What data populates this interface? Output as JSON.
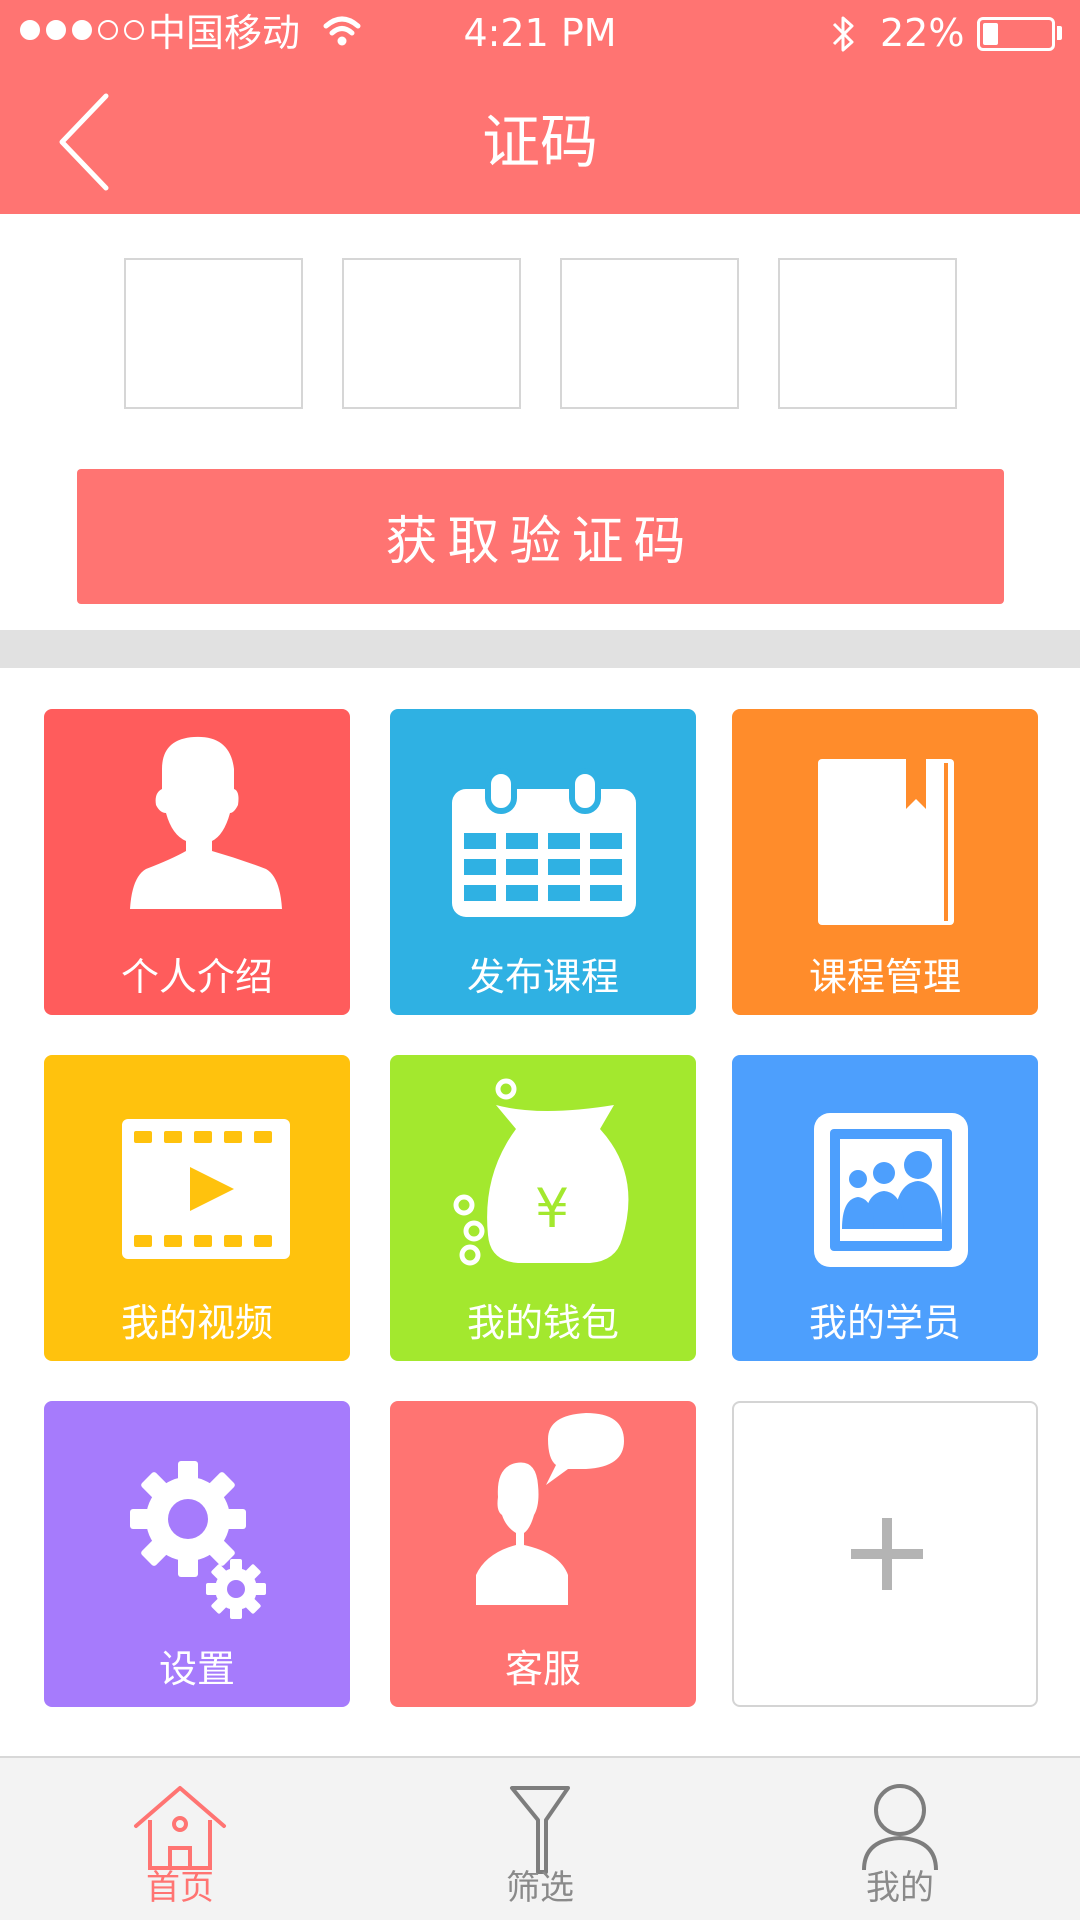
{
  "status_bar": {
    "carrier": "中国移动",
    "time": "4:21 PM",
    "battery": "22%",
    "battery_level": 0.22,
    "signal_bars": 3,
    "signal_total": 5
  },
  "nav": {
    "back_icon": "chevron-left-icon",
    "title": "证码"
  },
  "verification": {
    "code_values": [
      "",
      "",
      "",
      ""
    ],
    "button_label": "获取验证码"
  },
  "grid": {
    "tiles": [
      {
        "label": "个人介绍",
        "icon": "person-icon",
        "color": "#ff5c5c"
      },
      {
        "label": "发布课程",
        "icon": "calendar-icon",
        "color": "#2fb1e3"
      },
      {
        "label": "课程管理",
        "icon": "book-icon",
        "color": "#ff8c2b"
      },
      {
        "label": "我的视频",
        "icon": "film-icon",
        "color": "#ffc20d"
      },
      {
        "label": "我的钱包",
        "icon": "money-bag-icon",
        "color": "#a3e82e"
      },
      {
        "label": "我的学员",
        "icon": "students-icon",
        "color": "#4d9ffd"
      },
      {
        "label": "设置",
        "icon": "gear-icon",
        "color": "#a67bfc"
      },
      {
        "label": "客服",
        "icon": "customer-service-icon",
        "color": "#ff7472"
      },
      {
        "label": "",
        "icon": "plus-icon",
        "color": "#ffffff"
      }
    ]
  },
  "tabbar": {
    "tabs": [
      {
        "label": "首页",
        "icon": "home-icon",
        "active": true
      },
      {
        "label": "筛选",
        "icon": "filter-icon",
        "active": false
      },
      {
        "label": "我的",
        "icon": "profile-icon",
        "active": false
      }
    ],
    "active_color": "#ff7472",
    "inactive_color": "#8a8a8a"
  },
  "colors": {
    "brand": "#ff7472",
    "divider": "#e1e1e1"
  }
}
